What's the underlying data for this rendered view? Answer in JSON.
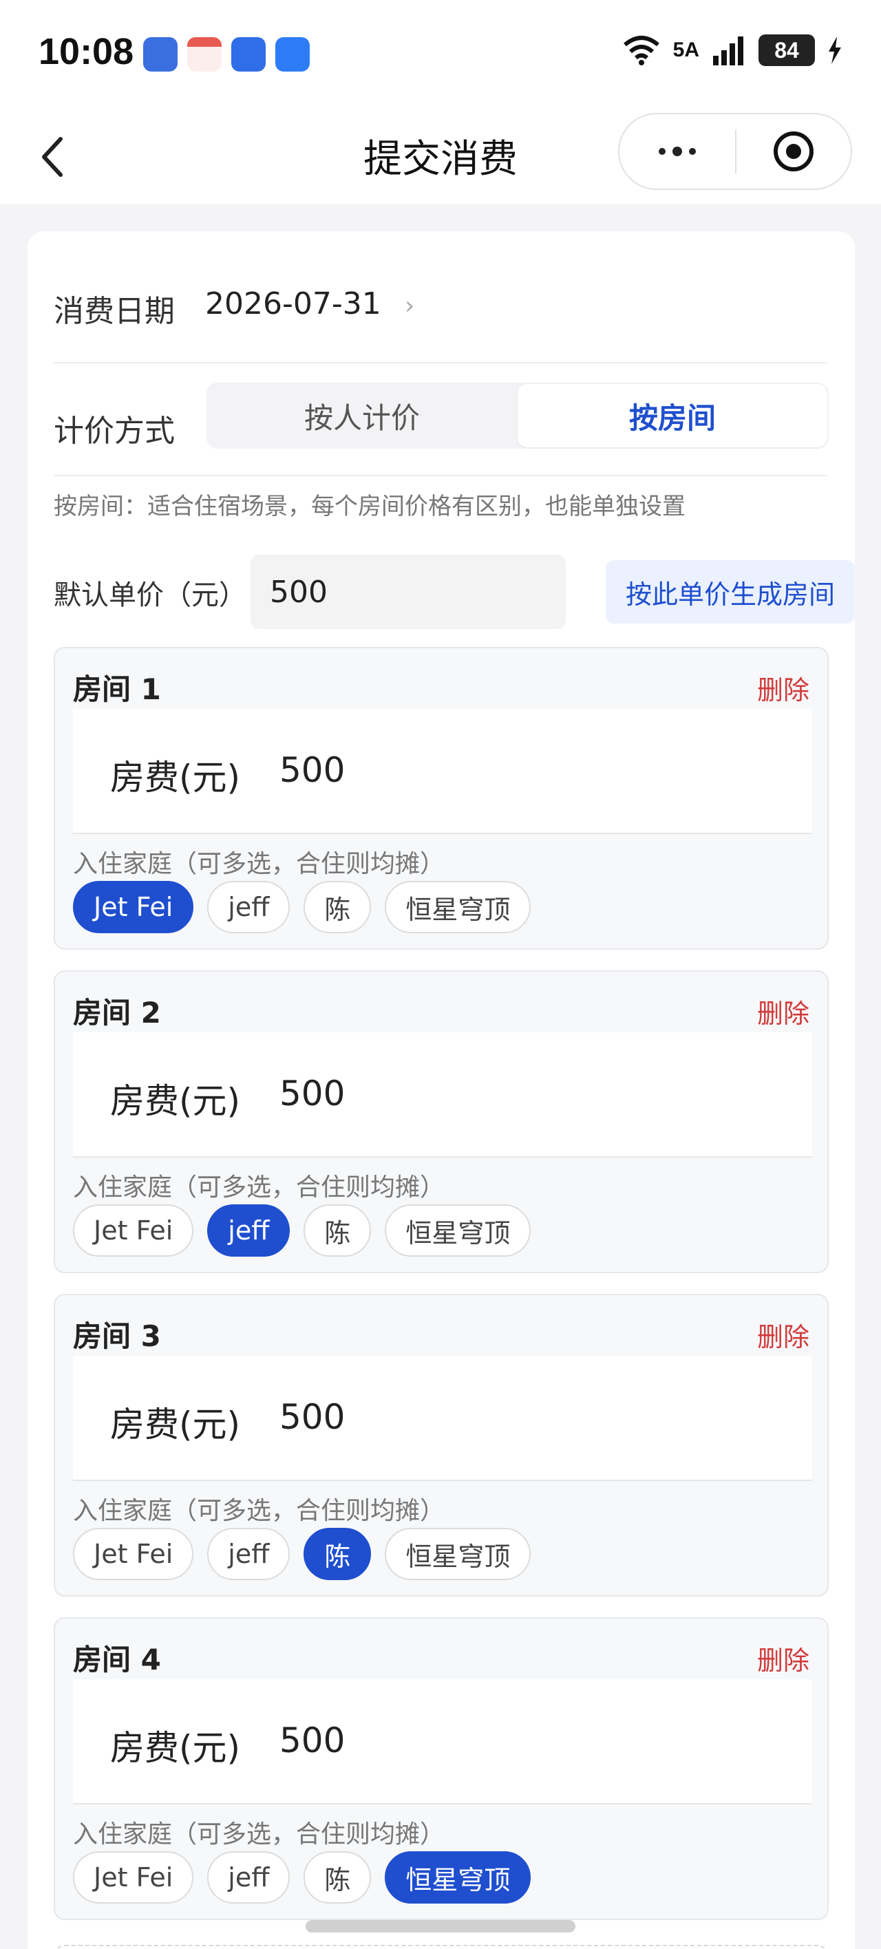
{
  "status_bar": {
    "time": "10:08",
    "network": "5A",
    "signal_prefix": "6",
    "battery": "84",
    "app_icons": [
      "hm-icon",
      "calendar-icon",
      "wifi-app-icon",
      "chat-icon"
    ]
  },
  "nav": {
    "title": "提交消费",
    "back_icon": "chevron-left-icon",
    "more_icon": "more-dots-icon",
    "target_icon": "record-target-icon"
  },
  "form": {
    "date_label": "消费日期",
    "date_value": "2026-07-31",
    "date_chevron": "›",
    "pricing_label": "计价方式",
    "pricing_options": [
      "按人计价",
      "按房间"
    ],
    "pricing_selected": "按房间",
    "hint": "按房间：适合住宿场景，每个房间价格有区别，也能单独设置",
    "default_price_label": "默认单价（元）",
    "default_price_value": "500",
    "generate_button": "按此单价生成房间"
  },
  "rooms": [
    {
      "title": "房间 1",
      "delete": "删除",
      "fee_label": "房费(元)",
      "fee_value": "500",
      "family_hint": "入住家庭（可多选，合住则均摊）",
      "families": [
        "Jet Fei",
        "jeff",
        "陈",
        "恒星穹顶"
      ],
      "selected": "Jet Fei"
    },
    {
      "title": "房间 2",
      "delete": "删除",
      "fee_label": "房费(元)",
      "fee_value": "500",
      "family_hint": "入住家庭（可多选，合住则均摊）",
      "families": [
        "Jet Fei",
        "jeff",
        "陈",
        "恒星穹顶"
      ],
      "selected": "jeff"
    },
    {
      "title": "房间 3",
      "delete": "删除",
      "fee_label": "房费(元)",
      "fee_value": "500",
      "family_hint": "入住家庭（可多选，合住则均摊）",
      "families": [
        "Jet Fei",
        "jeff",
        "陈",
        "恒星穹顶"
      ],
      "selected": "陈"
    },
    {
      "title": "房间 4",
      "delete": "删除",
      "fee_label": "房费(元)",
      "fee_value": "500",
      "family_hint": "入住家庭（可多选，合住则均摊）",
      "families": [
        "Jet Fei",
        "jeff",
        "陈",
        "恒星穹顶"
      ],
      "selected": "恒星穹顶"
    }
  ],
  "colors": {
    "accent": "#1f4fcf",
    "danger": "#d23b3b",
    "accent_light": "#ebf1fe"
  }
}
